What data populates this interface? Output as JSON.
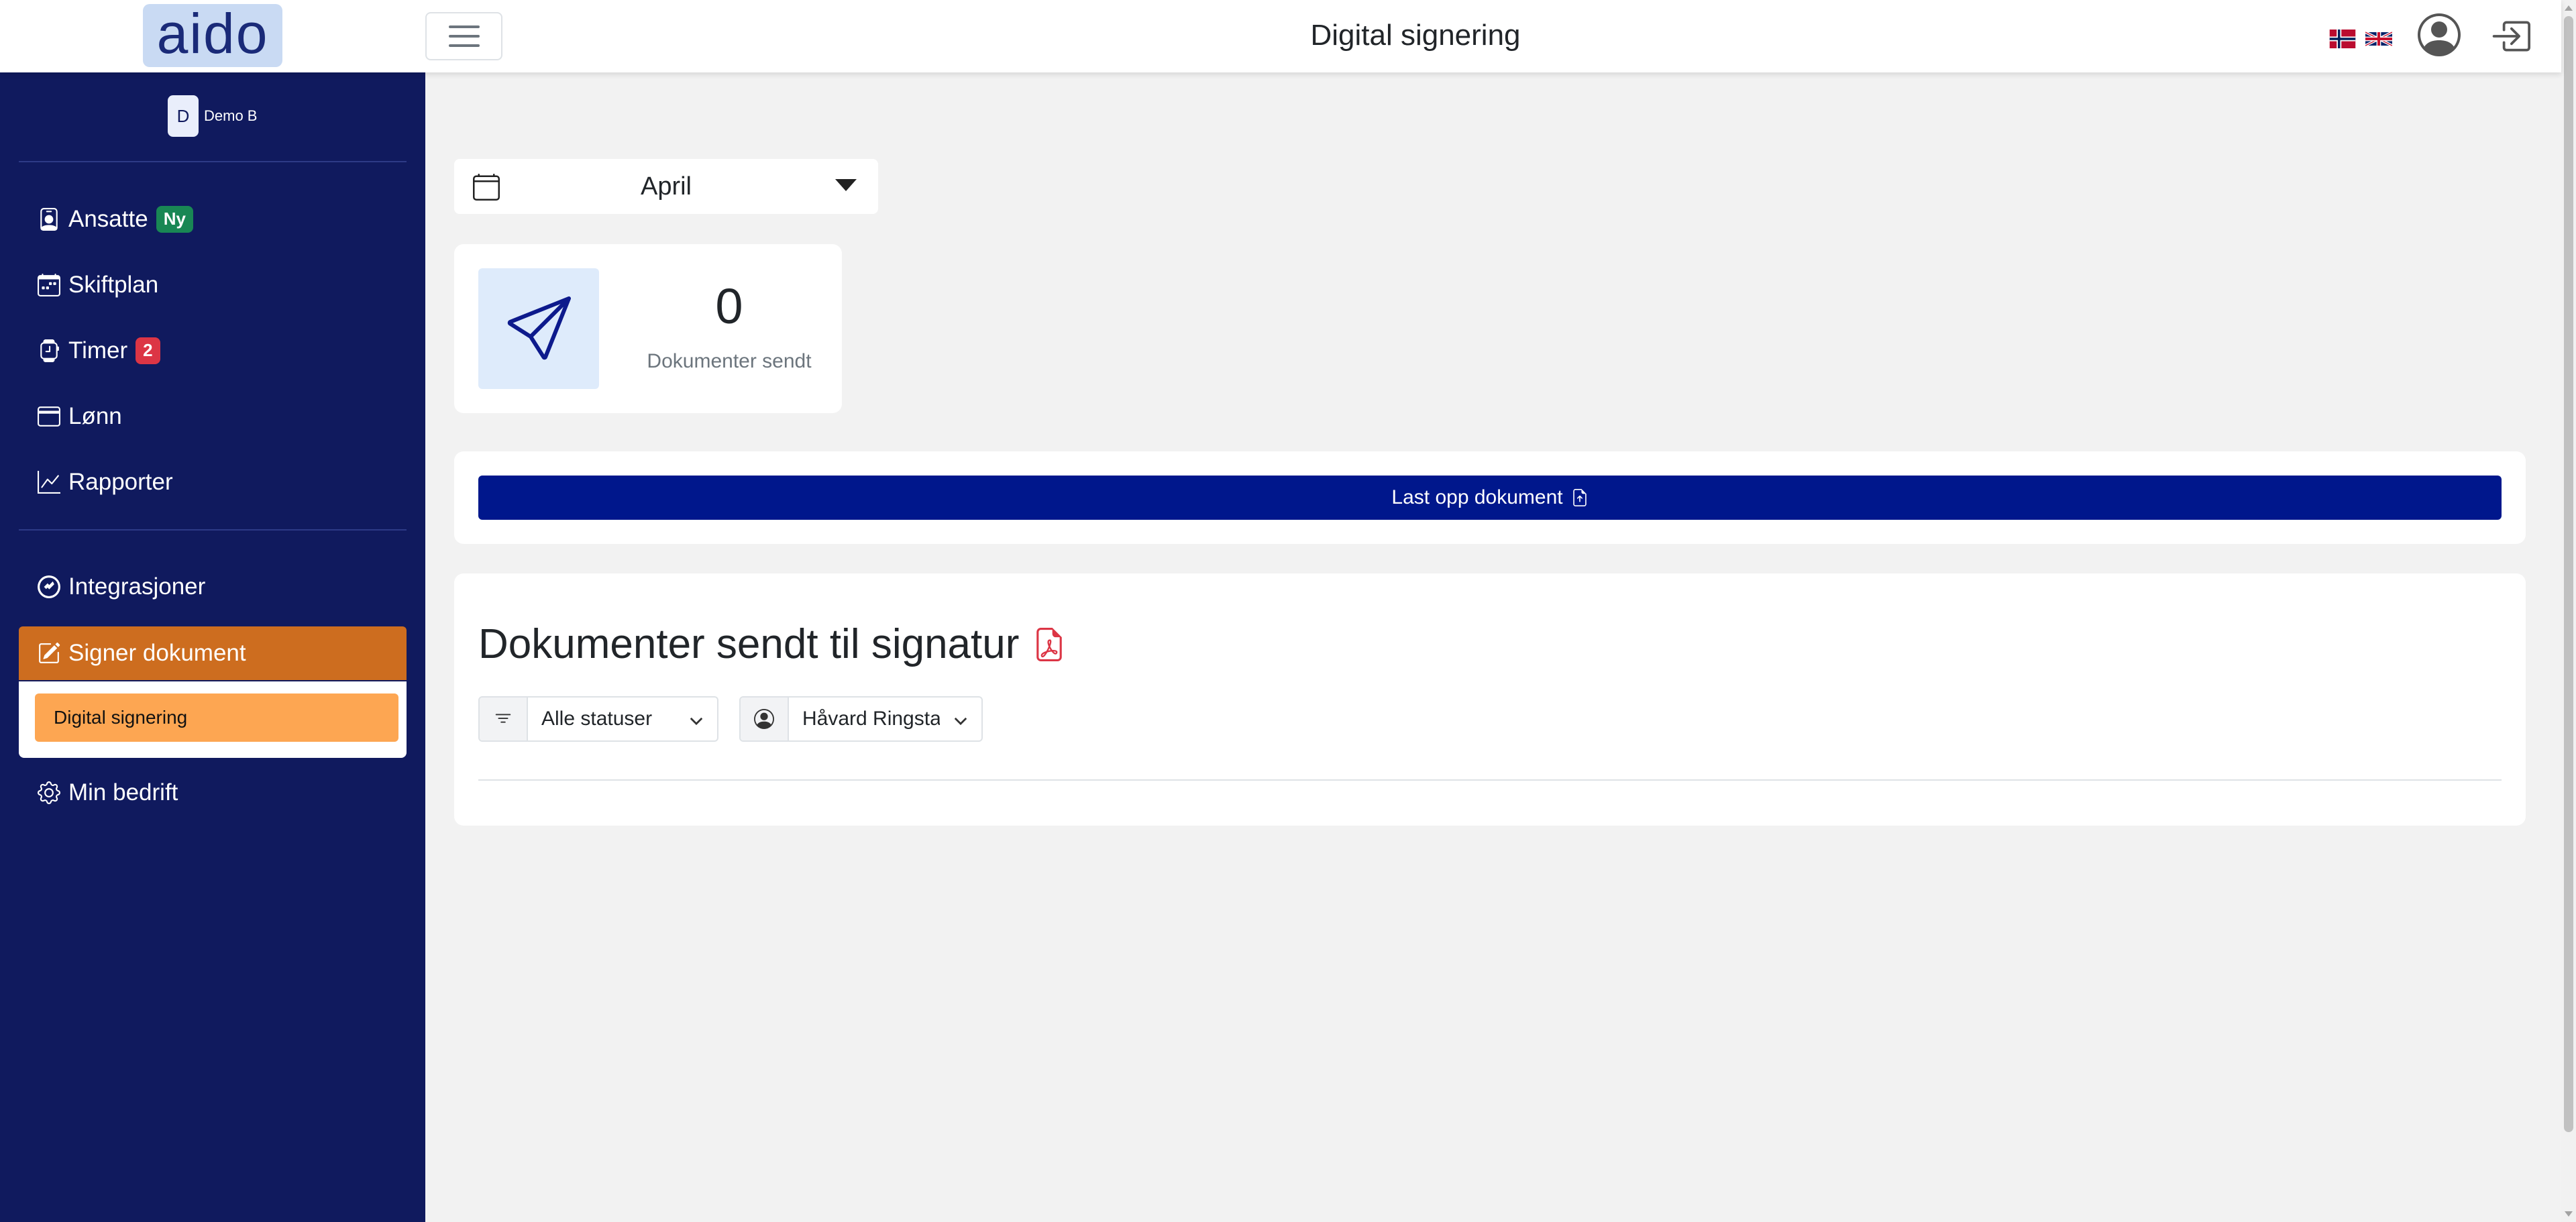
{
  "header": {
    "logo_text": "aido",
    "title": "Digital signering"
  },
  "sidebar": {
    "company": {
      "initial": "D",
      "name": "Demo B"
    },
    "items": [
      {
        "label": "Ansatte",
        "badge": "Ny",
        "icon": "person-badge-icon"
      },
      {
        "label": "Skiftplan",
        "icon": "calendar-week-icon"
      },
      {
        "label": "Timer",
        "badge": "2",
        "icon": "smartwatch-icon"
      },
      {
        "label": "Lønn",
        "icon": "wallet-icon"
      },
      {
        "label": "Rapporter",
        "icon": "graph-up-icon"
      },
      {
        "label": "Integrasjoner",
        "icon": "integration-icon"
      },
      {
        "label": "Signer dokument",
        "icon": "pencil-square-icon",
        "active": true,
        "submenu": [
          {
            "label": "Digital signering",
            "active": true
          }
        ]
      },
      {
        "label": "Min bedrift",
        "icon": "gear-icon"
      }
    ]
  },
  "main": {
    "month_select": {
      "value": "April"
    },
    "stat": {
      "value": "0",
      "label": "Dokumenter sendt"
    },
    "upload_button": {
      "label": "Last opp dokument"
    },
    "documents": {
      "title": "Dokumenter sendt til signatur",
      "status_filter": "Alle statuser",
      "user_filter": "Håvard Ringstad"
    }
  },
  "colors": {
    "sidebar_bg": "#101a5e",
    "active_item": "#cd6d1f",
    "submenu_active": "#fda652",
    "primary_button": "#00178c",
    "badge_new": "#198754",
    "badge_count": "#dc3545",
    "pdf_icon": "#dc3545"
  }
}
